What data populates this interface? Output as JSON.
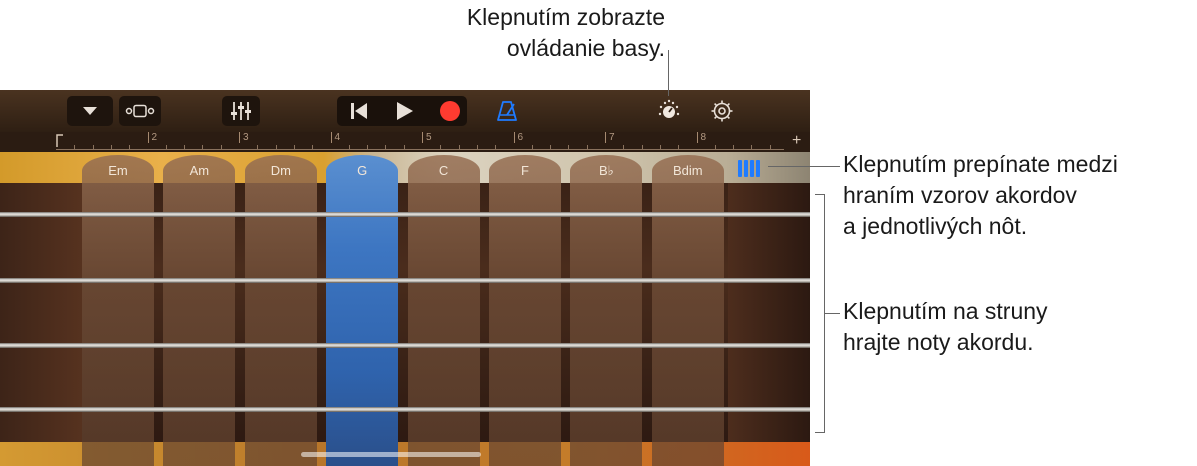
{
  "callouts": {
    "bass_controls": [
      "Klepnutím zobrazte",
      "ovládanie basy."
    ],
    "mode_toggle": [
      "Klepnutím prepínate medzi",
      "hraním vzorov akordov",
      "a jednotlivých nôt."
    ],
    "strings": [
      "Klepnutím na struny",
      "hrajte noty akordu."
    ]
  },
  "ruler": {
    "bars": [
      "2",
      "3",
      "4",
      "5",
      "6",
      "7",
      "8"
    ],
    "add": "+"
  },
  "chords": [
    {
      "label": "Em",
      "active": false
    },
    {
      "label": "Am",
      "active": false
    },
    {
      "label": "Dm",
      "active": false
    },
    {
      "label": "G",
      "active": true
    },
    {
      "label": "C",
      "active": false
    },
    {
      "label": "F",
      "active": false
    },
    {
      "label": "B♭",
      "active": false
    },
    {
      "label": "Bdim",
      "active": false
    }
  ],
  "colors": {
    "accent": "#1f7bff",
    "record": "#ff3b30",
    "active_chord": "#3d76c2"
  },
  "icons": {
    "browser": "chevron-down-icon",
    "tracks": "tracks-view-icon",
    "mixer": "mixer-sliders-icon",
    "rewind": "rewind-to-start-icon",
    "play": "play-icon",
    "record": "record-icon",
    "metronome": "metronome-icon",
    "controls": "controls-knob-icon",
    "settings": "gear-icon"
  }
}
